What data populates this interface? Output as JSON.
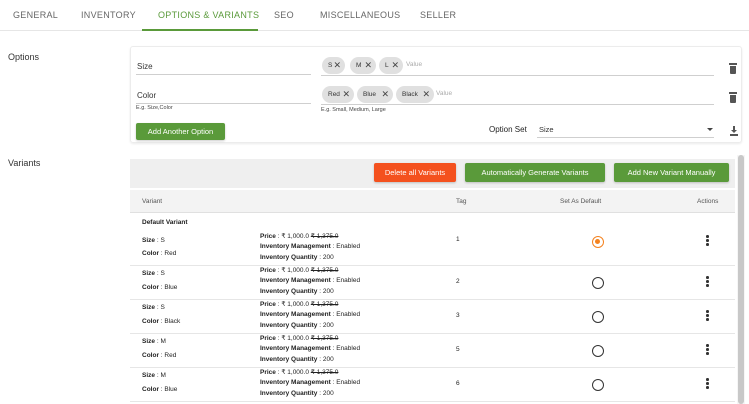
{
  "tabs": [
    {
      "label": "GENERAL"
    },
    {
      "label": "INVENTORY"
    },
    {
      "label": "OPTIONS & VARIANTS"
    },
    {
      "label": "SEO"
    },
    {
      "label": "MISCELLANEOUS"
    },
    {
      "label": "SELLER"
    }
  ],
  "active_tab": "OPTIONS & VARIANTS",
  "colors": {
    "accent": "#5a9a3a",
    "danger": "#f4511e",
    "radio_selected": "#f4821f"
  },
  "options": {
    "section_label": "Options",
    "rows": [
      {
        "name": "Size",
        "values": [
          "S",
          "M",
          "L"
        ],
        "placeholder": "Value",
        "hint": "",
        "delete_icon": "trash-icon"
      },
      {
        "name": "Color",
        "values": [
          "Red",
          "Blue",
          "Black"
        ],
        "placeholder": "Value",
        "hint": "E.g. Size,Color",
        "values_hint": "E.g. Small, Medium, Large",
        "delete_icon": "trash-icon"
      }
    ],
    "add_button": "Add Another Option",
    "option_set_label": "Option Set",
    "option_set_value": "Size",
    "download_icon": "download-icon"
  },
  "variants": {
    "section_label": "Variants",
    "delete_all": "Delete all Variants",
    "auto_generate": "Automatically Generate Variants",
    "add_manual": "Add New Variant Manually",
    "columns": [
      "Variant",
      "Tag",
      "Set As Default",
      "Actions"
    ],
    "default_label": "Default Variant",
    "labels": {
      "size": "Size",
      "color": "Color",
      "price": "Price",
      "inventory_management": "Inventory Management",
      "inventory_quantity": "Inventory Quantity"
    },
    "rows": [
      {
        "size": "S",
        "color": "Red",
        "price": "₹ 1,000.0",
        "compare_price": "₹ 1,375.0",
        "inventory_management": "Enabled",
        "inventory_quantity": "200",
        "tag": "1",
        "default": true
      },
      {
        "size": "S",
        "color": "Blue",
        "price": "₹ 1,000.0",
        "compare_price": "₹ 1,375.0",
        "inventory_management": "Enabled",
        "inventory_quantity": "200",
        "tag": "2",
        "default": false
      },
      {
        "size": "S",
        "color": "Black",
        "price": "₹ 1,000.0",
        "compare_price": "₹ 1,375.0",
        "inventory_management": "Enabled",
        "inventory_quantity": "200",
        "tag": "3",
        "default": false
      },
      {
        "size": "M",
        "color": "Red",
        "price": "₹ 1,000.0",
        "compare_price": "₹ 1,375.0",
        "inventory_management": "Enabled",
        "inventory_quantity": "200",
        "tag": "5",
        "default": false
      },
      {
        "size": "M",
        "color": "Blue",
        "price": "₹ 1,000.0",
        "compare_price": "₹ 1,375.0",
        "inventory_management": "Enabled",
        "inventory_quantity": "200",
        "tag": "6",
        "default": false
      }
    ]
  }
}
